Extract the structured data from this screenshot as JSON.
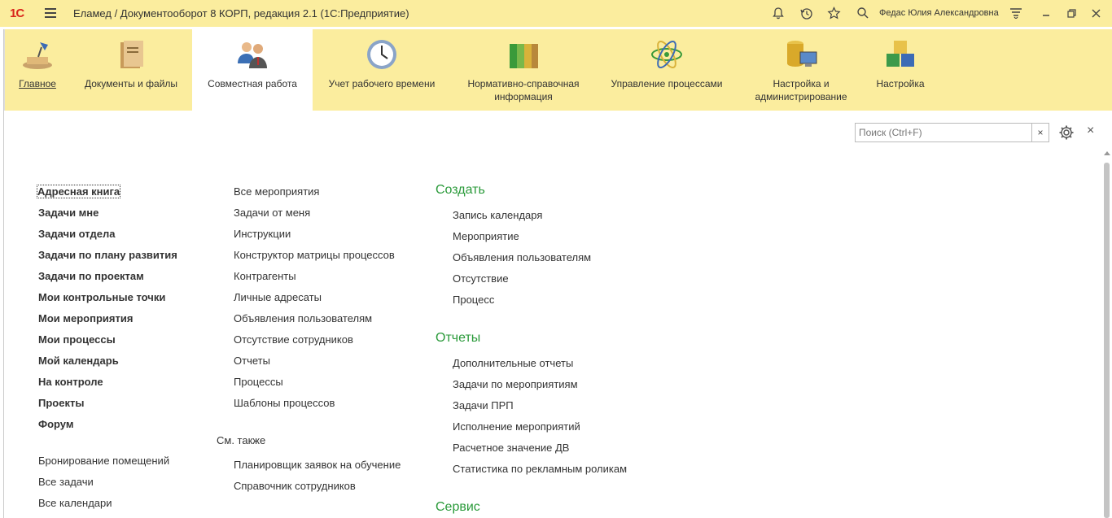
{
  "titlebar": {
    "logo": "1С",
    "title": "Еламед / Документооборот 8 КОРП, редакция 2.1  (1С:Предприятие)",
    "user": "Федас Юлия Александровна"
  },
  "sections": [
    {
      "label": "Главное",
      "active": false
    },
    {
      "label": "Документы и файлы",
      "active": false
    },
    {
      "label": "Совместная работа",
      "active": true
    },
    {
      "label": "Учет рабочего времени",
      "active": false
    },
    {
      "label": "Нормативно-справочная информация",
      "active": false
    },
    {
      "label": "Управление процессами",
      "active": false
    },
    {
      "label": "Настройка и администрирование",
      "active": false
    },
    {
      "label": "Настройка",
      "active": false
    }
  ],
  "search": {
    "placeholder": "Поиск (Ctrl+F)",
    "clear": "×"
  },
  "col1": {
    "bold": [
      "Адресная книга",
      "Задачи мне",
      "Задачи отдела",
      "Задачи по плану развития",
      "Задачи по проектам",
      "Мои контрольные точки",
      "Мои мероприятия",
      "Мои процессы",
      "Мой календарь",
      "На контроле",
      "Проекты",
      "Форум"
    ],
    "normal": [
      "Бронирование помещений",
      "Все задачи",
      "Все календари"
    ]
  },
  "col2": {
    "items": [
      "Все мероприятия",
      "Задачи от меня",
      "Инструкции",
      "Конструктор матрицы процессов",
      "Контрагенты",
      "Личные адресаты",
      "Объявления пользователям",
      "Отсутствие сотрудников",
      "Отчеты",
      "Процессы",
      "Шаблоны процессов"
    ],
    "see_also_title": "См. также",
    "see_also": [
      "Планировщик заявок на обучение",
      "Справочник сотрудников"
    ]
  },
  "col3": {
    "create_title": "Создать",
    "create": [
      "Запись календаря",
      "Мероприятие",
      "Объявления пользователям",
      "Отсутствие",
      "Процесс"
    ],
    "reports_title": "Отчеты",
    "reports": [
      "Дополнительные отчеты",
      "Задачи по мероприятиям",
      "Задачи ПРП",
      "Исполнение мероприятий",
      "Расчетное значение ДВ",
      "Статистика по рекламным роликам"
    ],
    "service_title": "Сервис"
  },
  "colors": {
    "accent_bar": "#fbed9e",
    "group_title": "#2a9a3a"
  }
}
